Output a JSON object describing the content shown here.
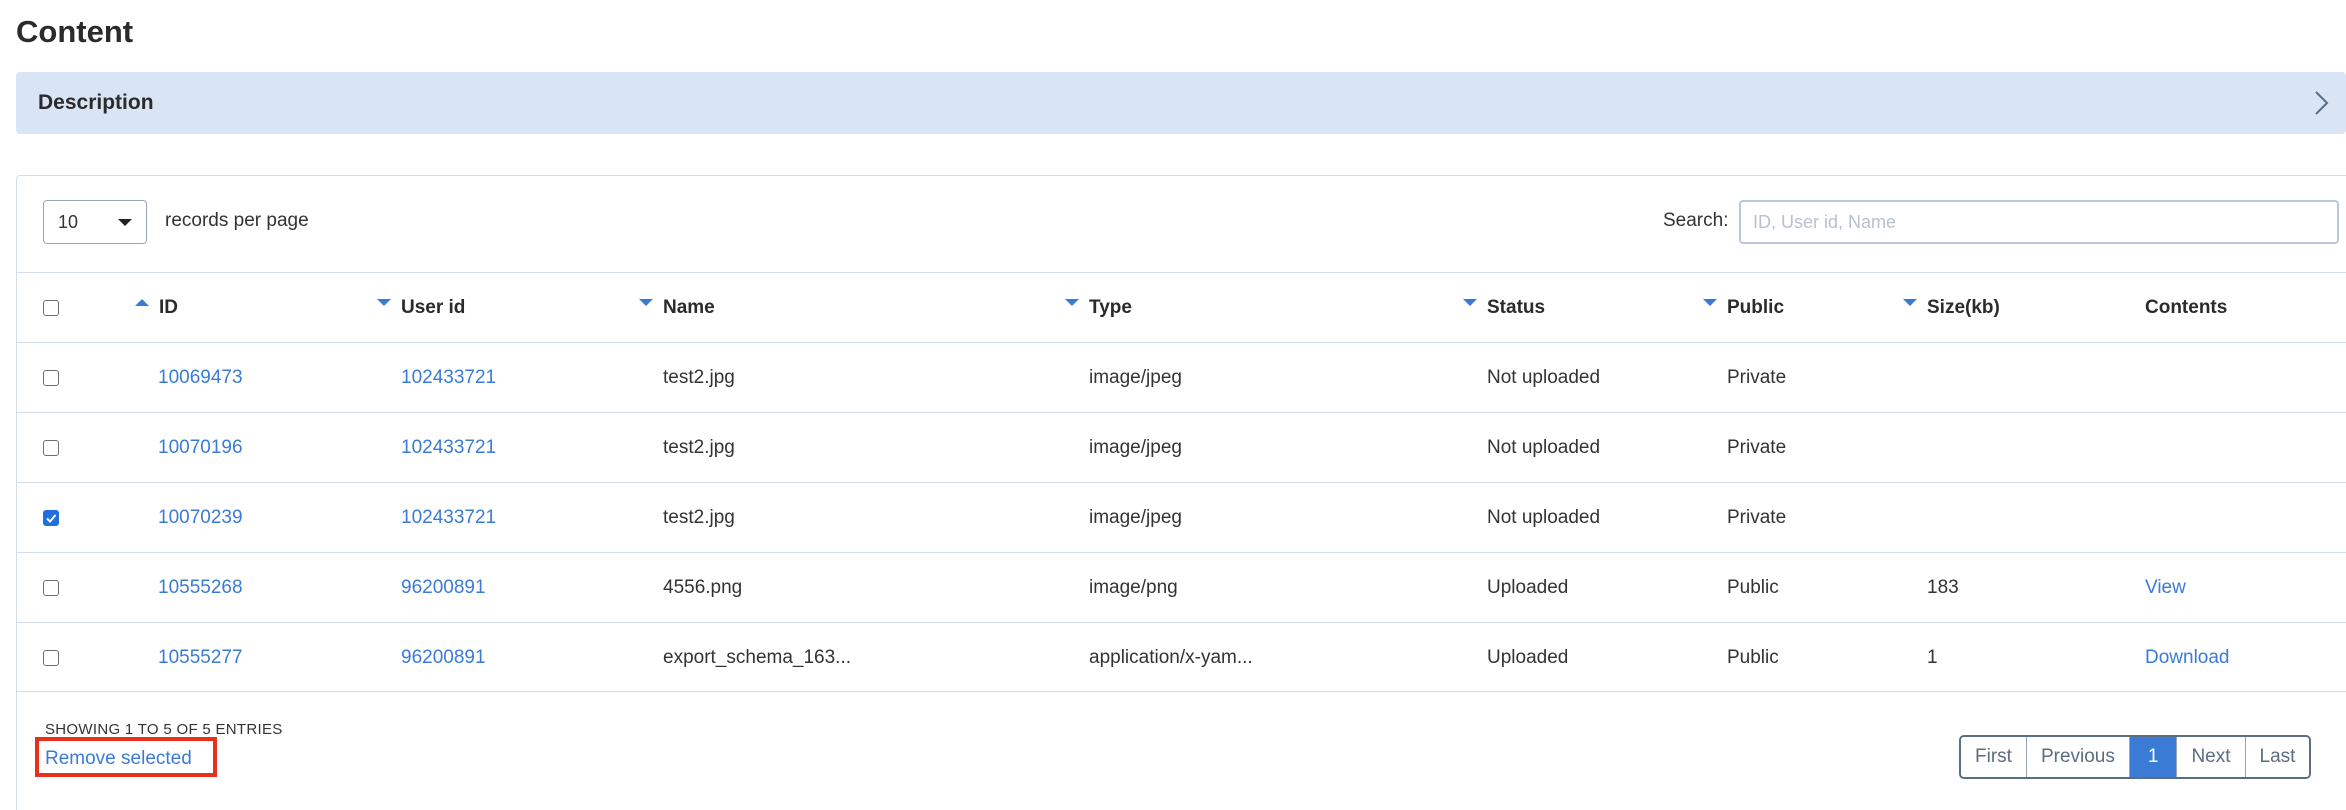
{
  "page": {
    "title": "Content"
  },
  "description": {
    "label": "Description"
  },
  "length": {
    "value": "10",
    "label": "records per page"
  },
  "search": {
    "label": "Search:",
    "placeholder": "ID, User id, Name",
    "value": ""
  },
  "table": {
    "headers": {
      "id": "ID",
      "user_id": "User id",
      "name": "Name",
      "type": "Type",
      "status": "Status",
      "public": "Public",
      "size": "Size(kb)",
      "contents": "Contents"
    },
    "rows": [
      {
        "checked": false,
        "id": "10069473",
        "user_id": "102433721",
        "name": "test2.jpg",
        "type": "image/jpeg",
        "status": "Not uploaded",
        "public": "Private",
        "size": "",
        "contents": ""
      },
      {
        "checked": false,
        "id": "10070196",
        "user_id": "102433721",
        "name": "test2.jpg",
        "type": "image/jpeg",
        "status": "Not uploaded",
        "public": "Private",
        "size": "",
        "contents": ""
      },
      {
        "checked": true,
        "id": "10070239",
        "user_id": "102433721",
        "name": "test2.jpg",
        "type": "image/jpeg",
        "status": "Not uploaded",
        "public": "Private",
        "size": "",
        "contents": ""
      },
      {
        "checked": false,
        "id": "10555268",
        "user_id": "96200891",
        "name": "4556.png",
        "type": "image/png",
        "status": "Uploaded",
        "public": "Public",
        "size": "183",
        "contents": "View"
      },
      {
        "checked": false,
        "id": "10555277",
        "user_id": "96200891",
        "name": "export_schema_163...",
        "type": "application/x-yam...",
        "status": "Uploaded",
        "public": "Public",
        "size": "1",
        "contents": "Download"
      }
    ]
  },
  "footer": {
    "info": "SHOWING 1 TO 5 OF 5 ENTRIES",
    "remove_label": "Remove selected"
  },
  "pagination": {
    "first": "First",
    "previous": "Previous",
    "current": "1",
    "next": "Next",
    "last": "Last"
  },
  "colors": {
    "accent": "#3a7bd5",
    "description_bg": "#d9e4f4",
    "highlight": "#e8301e"
  }
}
